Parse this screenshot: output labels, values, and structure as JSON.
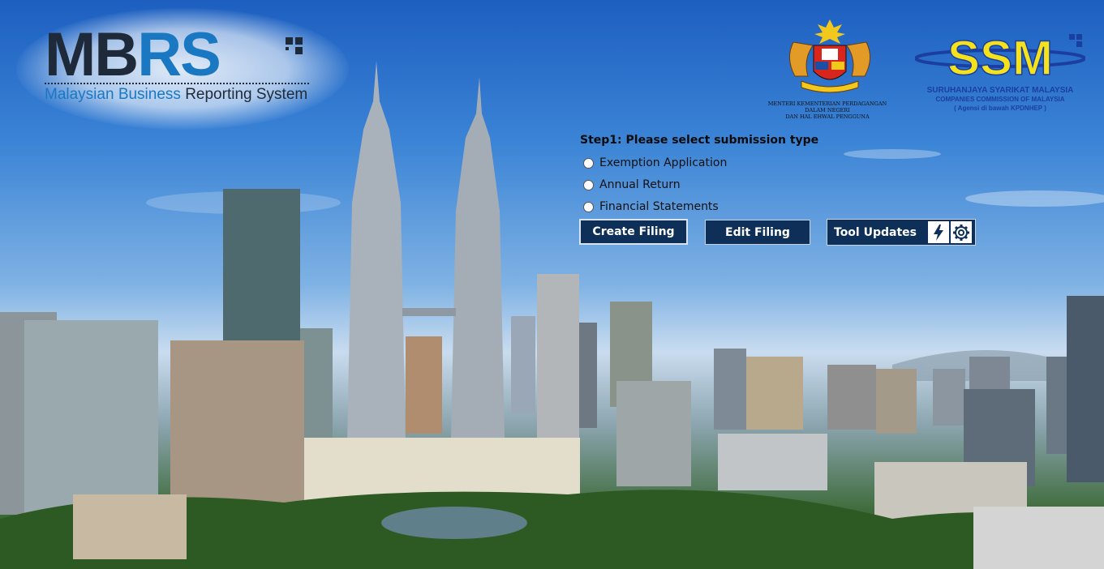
{
  "header": {
    "mbrs_logo": {
      "mb": "MB",
      "rs": "RS",
      "subtitle_part1": "Malaysian Business",
      "subtitle_part2": "Reporting System"
    },
    "crest_caption_line1": "MENTERI KEMENTERIAN PERDAGANGAN DALAM NEGERI",
    "crest_caption_line2": "DAN HAL EHWAL PENGGUNA",
    "ssm": {
      "logo_text": "SSM",
      "name_line1": "SURUHANJAYA SYARIKAT MALAYSIA",
      "name_line2": "COMPANIES COMMISSION OF MALAYSIA",
      "name_line3": "( Agensi di bawah KPDNHEP )"
    }
  },
  "form": {
    "step_title": "Step1: Please select submission type",
    "options": [
      {
        "label": "Exemption Application",
        "selected": false
      },
      {
        "label": "Annual Return",
        "selected": false
      },
      {
        "label": "Financial Statements",
        "selected": false
      }
    ],
    "buttons": {
      "create": "Create Filing",
      "edit": "Edit Filing",
      "tool_updates": "Tool Updates"
    }
  },
  "colors": {
    "button_bg": "#0e3058",
    "brand_blue": "#1a78c2",
    "ssm_yellow": "#f5e21b"
  }
}
